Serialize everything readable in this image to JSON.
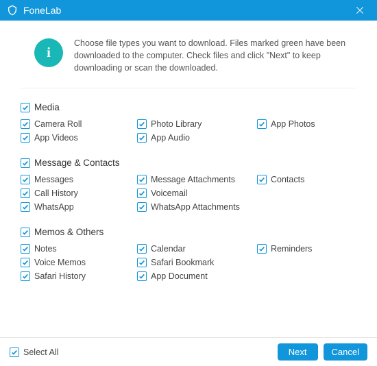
{
  "title": "FoneLab",
  "intro": "Choose file types you want to download. Files marked green have been downloaded to the computer. Check files and click \"Next\" to keep downloading or scan the downloaded.",
  "sections": [
    {
      "label": "Media",
      "items": [
        "Camera Roll",
        "Photo Library",
        "App Photos",
        "App Videos",
        "App Audio"
      ]
    },
    {
      "label": "Message & Contacts",
      "items": [
        "Messages",
        "Message Attachments",
        "Contacts",
        "Call History",
        "Voicemail",
        "",
        "WhatsApp",
        "WhatsApp Attachments"
      ]
    },
    {
      "label": "Memos & Others",
      "items": [
        "Notes",
        "Calendar",
        "Reminders",
        "Voice Memos",
        "Safari Bookmark",
        "",
        "Safari History",
        "App Document"
      ]
    }
  ],
  "footer": {
    "selectAll": "Select All",
    "next": "Next",
    "cancel": "Cancel"
  },
  "colors": {
    "accent": "#1296db",
    "info": "#19b7b5"
  }
}
